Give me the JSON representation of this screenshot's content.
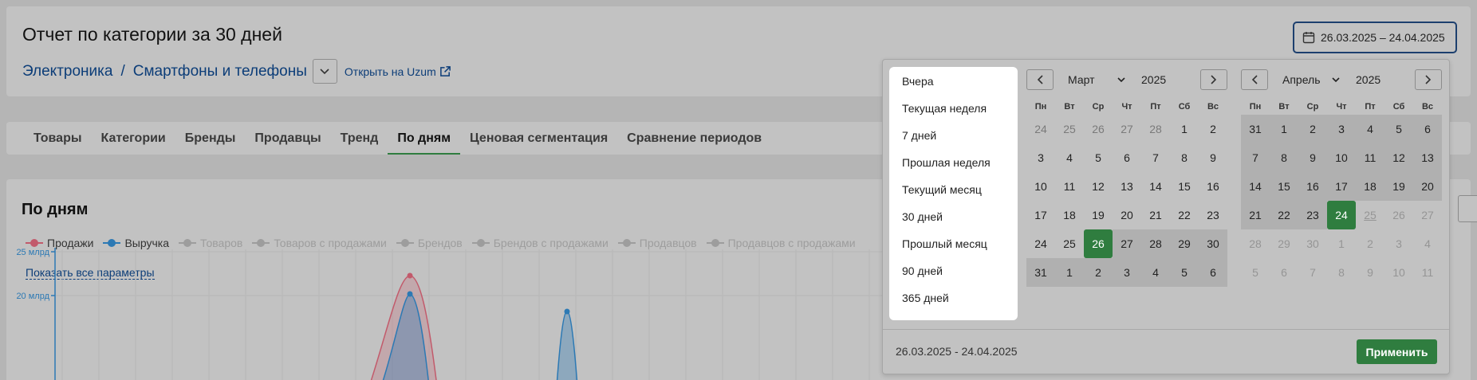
{
  "header": {
    "title": "Отчет по категории за 30 дней",
    "breadcrumb": [
      "Электроника",
      "Смартфоны и телефоны"
    ],
    "breadcrumb_sep": "/",
    "open_link": "Открыть на Uzum",
    "date_range": "26.03.2025 – 24.04.2025"
  },
  "tabs": [
    "Товары",
    "Категории",
    "Бренды",
    "Продавцы",
    "Тренд",
    "По дням",
    "Ценовая сегментация",
    "Сравнение периодов"
  ],
  "active_tab": "По дням",
  "chart": {
    "title": "По дням",
    "legend": [
      {
        "label": "Продажи",
        "active": true
      },
      {
        "label": "Выручка",
        "active": true
      },
      {
        "label": "Товаров",
        "active": false
      },
      {
        "label": "Товаров с продажами",
        "active": false
      },
      {
        "label": "Брендов",
        "active": false
      },
      {
        "label": "Брендов с продажами",
        "active": false
      },
      {
        "label": "Продавцов",
        "active": false
      },
      {
        "label": "Продавцов с продажами",
        "active": false
      }
    ],
    "show_all": "Показать все параметры",
    "colors": {
      "sales": "#c25a6b",
      "revenue": "#2c79b4",
      "inactive": "#9d9d9d"
    }
  },
  "chart_data": {
    "type": "area",
    "y_tick_labels": [
      "25 млрд",
      "20 млрд"
    ],
    "series": [
      {
        "name": "Продажи",
        "color": "#c25a6b"
      },
      {
        "name": "Выручка",
        "color": "#2c79b4"
      }
    ]
  },
  "picker": {
    "presets": [
      "Вчера",
      "Текущая неделя",
      "7 дней",
      "Прошлая неделя",
      "Текущий месяц",
      "30 дней",
      "Прошлый месяц",
      "90 дней",
      "365 дней"
    ],
    "weekdays": [
      "Пн",
      "Вт",
      "Ср",
      "Чт",
      "Пт",
      "Сб",
      "Вс"
    ],
    "prev_icon": "chevron-left-icon",
    "next_icon": "chevron-right-icon",
    "left_calendar": {
      "month": "Март",
      "year": "2025",
      "days": [
        {
          "d": "24",
          "s": "mut"
        },
        {
          "d": "25",
          "s": "mut"
        },
        {
          "d": "26",
          "s": "mut"
        },
        {
          "d": "27",
          "s": "mut"
        },
        {
          "d": "28",
          "s": "mut"
        },
        {
          "d": "1",
          "s": ""
        },
        {
          "d": "2",
          "s": ""
        },
        {
          "d": "3",
          "s": ""
        },
        {
          "d": "4",
          "s": ""
        },
        {
          "d": "5",
          "s": ""
        },
        {
          "d": "6",
          "s": ""
        },
        {
          "d": "7",
          "s": ""
        },
        {
          "d": "8",
          "s": ""
        },
        {
          "d": "9",
          "s": ""
        },
        {
          "d": "10",
          "s": ""
        },
        {
          "d": "11",
          "s": ""
        },
        {
          "d": "12",
          "s": ""
        },
        {
          "d": "13",
          "s": ""
        },
        {
          "d": "14",
          "s": ""
        },
        {
          "d": "15",
          "s": ""
        },
        {
          "d": "16",
          "s": ""
        },
        {
          "d": "17",
          "s": ""
        },
        {
          "d": "18",
          "s": ""
        },
        {
          "d": "19",
          "s": ""
        },
        {
          "d": "20",
          "s": ""
        },
        {
          "d": "21",
          "s": ""
        },
        {
          "d": "22",
          "s": ""
        },
        {
          "d": "23",
          "s": ""
        },
        {
          "d": "24",
          "s": ""
        },
        {
          "d": "25",
          "s": ""
        },
        {
          "d": "26",
          "s": "sel"
        },
        {
          "d": "27",
          "s": "inr"
        },
        {
          "d": "28",
          "s": "inr"
        },
        {
          "d": "29",
          "s": "inr"
        },
        {
          "d": "30",
          "s": "inr"
        },
        {
          "d": "31",
          "s": "inr"
        },
        {
          "d": "1",
          "s": "inr"
        },
        {
          "d": "2",
          "s": "inr"
        },
        {
          "d": "3",
          "s": "inr"
        },
        {
          "d": "4",
          "s": "inr"
        },
        {
          "d": "5",
          "s": "inr"
        },
        {
          "d": "6",
          "s": "inr"
        }
      ]
    },
    "right_calendar": {
      "month": "Апрель",
      "year": "2025",
      "days": [
        {
          "d": "31",
          "s": "inr"
        },
        {
          "d": "1",
          "s": "inr"
        },
        {
          "d": "2",
          "s": "inr"
        },
        {
          "d": "3",
          "s": "inr"
        },
        {
          "d": "4",
          "s": "inr"
        },
        {
          "d": "5",
          "s": "inr"
        },
        {
          "d": "6",
          "s": "inr"
        },
        {
          "d": "7",
          "s": "inr"
        },
        {
          "d": "8",
          "s": "inr"
        },
        {
          "d": "9",
          "s": "inr"
        },
        {
          "d": "10",
          "s": "inr"
        },
        {
          "d": "11",
          "s": "inr"
        },
        {
          "d": "12",
          "s": "inr"
        },
        {
          "d": "13",
          "s": "inr"
        },
        {
          "d": "14",
          "s": "inr"
        },
        {
          "d": "15",
          "s": "inr"
        },
        {
          "d": "16",
          "s": "inr"
        },
        {
          "d": "17",
          "s": "inr"
        },
        {
          "d": "18",
          "s": "inr"
        },
        {
          "d": "19",
          "s": "inr"
        },
        {
          "d": "20",
          "s": "inr"
        },
        {
          "d": "21",
          "s": "inr"
        },
        {
          "d": "22",
          "s": "inr"
        },
        {
          "d": "23",
          "s": "inr"
        },
        {
          "d": "24",
          "s": "sel"
        },
        {
          "d": "25",
          "s": "fut today"
        },
        {
          "d": "26",
          "s": "fut"
        },
        {
          "d": "27",
          "s": "fut"
        },
        {
          "d": "28",
          "s": "fut"
        },
        {
          "d": "29",
          "s": "fut"
        },
        {
          "d": "30",
          "s": "fut"
        },
        {
          "d": "1",
          "s": "fut"
        },
        {
          "d": "2",
          "s": "fut"
        },
        {
          "d": "3",
          "s": "fut"
        },
        {
          "d": "4",
          "s": "fut"
        },
        {
          "d": "5",
          "s": "fut"
        },
        {
          "d": "6",
          "s": "fut"
        },
        {
          "d": "7",
          "s": "fut"
        },
        {
          "d": "8",
          "s": "fut"
        },
        {
          "d": "9",
          "s": "fut"
        },
        {
          "d": "10",
          "s": "fut"
        },
        {
          "d": "11",
          "s": "fut"
        }
      ]
    },
    "footer_range": "26.03.2025 - 24.04.2025",
    "apply": "Применить"
  }
}
